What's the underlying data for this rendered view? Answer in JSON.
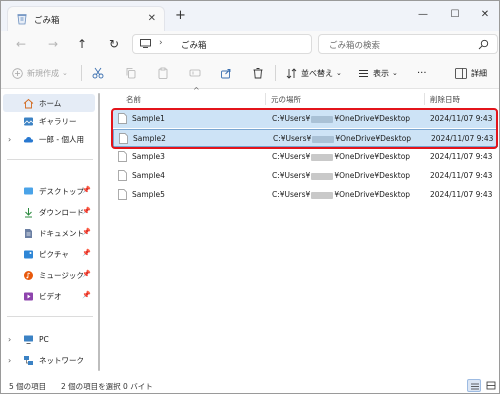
{
  "window": {
    "tab_title": "ごみ箱",
    "new_tab": "+",
    "tab_close": "✕",
    "minimize": "—",
    "maximize": "☐",
    "close": "✕"
  },
  "address": {
    "back": "←",
    "forward": "→",
    "up": "↑",
    "refresh": "↻",
    "chevron": "›",
    "path": "ごみ箱",
    "search_placeholder": "ごみ箱の検索"
  },
  "toolbar": {
    "new_label": "新規作成",
    "sort_label": "並べ替え",
    "view_label": "表示",
    "more": "···",
    "details_label": "詳細"
  },
  "sidebar": {
    "items": [
      {
        "label": "ホーム",
        "icon": "home-icon"
      },
      {
        "label": "ギャラリー",
        "icon": "gallery-icon"
      },
      {
        "label": "一郎 - 個人用",
        "icon": "cloud-icon"
      },
      {
        "label": "デスクトップ",
        "icon": "desktop-icon"
      },
      {
        "label": "ダウンロード",
        "icon": "download-icon"
      },
      {
        "label": "ドキュメント",
        "icon": "document-icon"
      },
      {
        "label": "ピクチャ",
        "icon": "pictures-icon"
      },
      {
        "label": "ミュージック",
        "icon": "music-icon"
      },
      {
        "label": "ビデオ",
        "icon": "video-icon"
      },
      {
        "label": "PC",
        "icon": "pc-icon"
      },
      {
        "label": "ネットワーク",
        "icon": "network-icon"
      }
    ],
    "pin": "📌",
    "expand": "›"
  },
  "columns": {
    "name": "名前",
    "location": "元の場所",
    "deleted": "削除日時",
    "sort_indicator": "^"
  },
  "files": [
    {
      "name": "Sample1",
      "loc_prefix": "C:¥Users¥",
      "loc_suffix": "¥OneDrive¥Desktop",
      "date": "2024/11/07 9:43",
      "selected": true
    },
    {
      "name": "Sample2",
      "loc_prefix": "C:¥Users¥",
      "loc_suffix": "¥OneDrive¥Desktop",
      "date": "2024/11/07 9:43",
      "selected": true
    },
    {
      "name": "Sample3",
      "loc_prefix": "C:¥Users¥",
      "loc_suffix": "¥OneDrive¥Desktop",
      "date": "2024/11/07 9:43",
      "selected": false
    },
    {
      "name": "Sample4",
      "loc_prefix": "C:¥Users¥",
      "loc_suffix": "¥OneDrive¥Desktop",
      "date": "2024/11/07 9:43",
      "selected": false
    },
    {
      "name": "Sample5",
      "loc_prefix": "C:¥Users¥",
      "loc_suffix": "¥OneDrive¥Desktop",
      "date": "2024/11/07 9:43",
      "selected": false
    }
  ],
  "status": {
    "items": "5 個の項目",
    "selected": "2 個の項目を選択 0 バイト"
  },
  "colors": {
    "accent": "#0067c0",
    "selection": "#cde3f6",
    "highlight_border": "#e3141b"
  }
}
